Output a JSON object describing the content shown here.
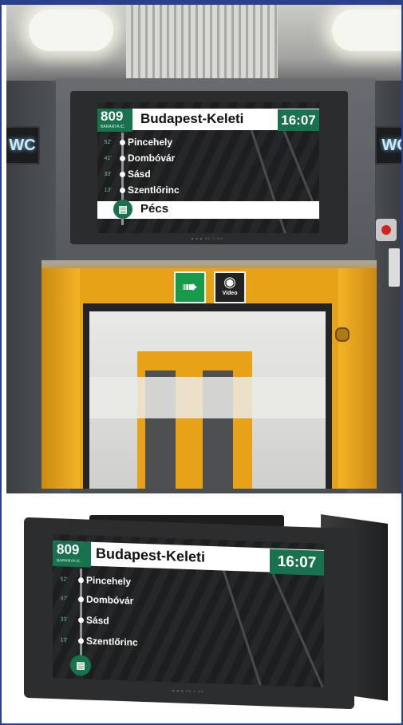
{
  "photo_in_train": {
    "display": {
      "route_number": "809",
      "route_sub": "BARANYA IC",
      "destination": "Budapest-Keleti",
      "time": "16:07",
      "stops": [
        {
          "minutes": "52'",
          "name": "Pincehely"
        },
        {
          "minutes": "41'",
          "name": "Dombóvár"
        },
        {
          "minutes": "33'",
          "name": "Sásd"
        },
        {
          "minutes": "13'",
          "name": "Szentlőrinc"
        }
      ],
      "current_stop": "Pécs",
      "brand": "■ ■ ■ NE.X.ON"
    },
    "wc_sign_left": "WC",
    "wc_sign_right": "WC",
    "camera_sign": "Video"
  },
  "product_photo": {
    "display": {
      "route_number": "809",
      "route_sub": "BARANYA IC",
      "destination": "Budapest-Keleti",
      "time": "16:07",
      "stops": [
        {
          "minutes": "52'",
          "name": "Pincehely"
        },
        {
          "minutes": "47'",
          "name": "Dombóvár"
        },
        {
          "minutes": "33'",
          "name": "Sásd"
        },
        {
          "minutes": "13'",
          "name": "Szentlőrinc"
        }
      ],
      "brand": "■ ■ ■ NE.X.ON"
    }
  },
  "colors": {
    "accent_green": "#19724e",
    "frame_blue": "#2b3f8f",
    "door_yellow": "#e8a218"
  }
}
